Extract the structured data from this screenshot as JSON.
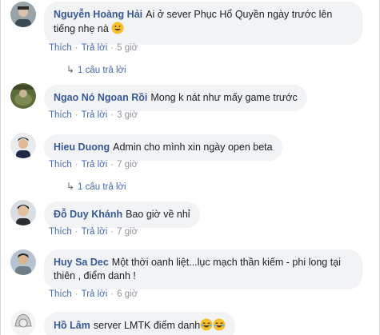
{
  "actions": {
    "like": "Thích",
    "reply": "Trả lời",
    "separator": "·"
  },
  "comments": [
    {
      "author": "Nguyễn Hoàng Hải",
      "text": "Ai ở sever Phục Hổ Quyền ngày trước lên tiếng nhẹ nà",
      "emoji": "grinning-face",
      "time": "5 giờ",
      "replies": "1 câu trả lời"
    },
    {
      "author": "Ngao Nó Ngoan Rồi",
      "text": "Mong k nát như mấy game trước",
      "time": "3 giờ"
    },
    {
      "author": "Hieu Duong",
      "text": "Admin cho mình xin ngày open beta",
      "time": "7 giờ",
      "replies": "1 câu trả lời"
    },
    {
      "author": "Đỗ Duy Khánh",
      "text": "Bao giờ về nhỉ",
      "time": "7 giờ"
    },
    {
      "author": "Huy Sa Dec",
      "text": "Một thời oanh liệt...lục mạch thần kiếm - phi long tại thiên , điểm danh !",
      "time": "6 giờ"
    },
    {
      "author": "Hồ Lâm",
      "text": "server LMTK điểm danh",
      "emoji": "laughing-face x2"
    }
  ]
}
